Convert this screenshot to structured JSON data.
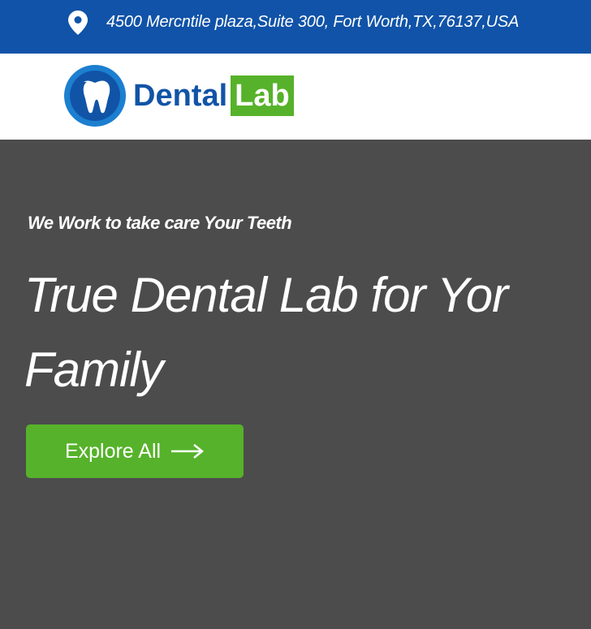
{
  "topbar": {
    "icon": "location-pin-icon",
    "address": "4500 Mercntile plaza,Suite 300, Fort Worth,TX,76137,USA"
  },
  "header": {
    "logo": {
      "icon": "tooth-icon",
      "text_primary": "Dental",
      "text_accent": "Lab"
    }
  },
  "hero": {
    "tagline": "We Work to take care Your Teeth",
    "headline": "True Dental Lab for Yor Family",
    "cta": {
      "label": "Explore All",
      "icon": "arrow-right-icon"
    }
  },
  "colors": {
    "topbar_bg": "#1053a8",
    "brand_blue": "#1154a7",
    "brand_green": "#56b22a",
    "hero_bg": "#4c4c4c"
  }
}
